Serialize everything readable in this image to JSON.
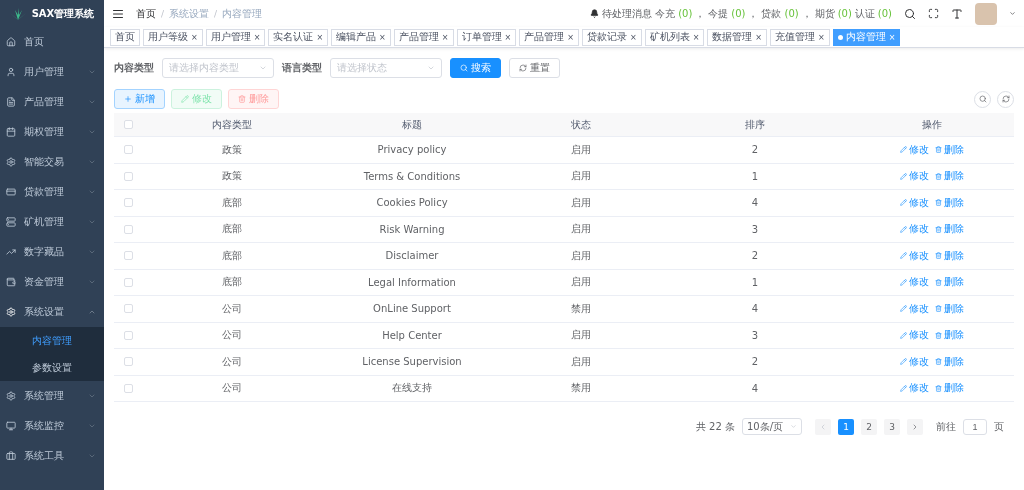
{
  "sidebar": {
    "brand": "SAX管理系统",
    "items": [
      {
        "label": "首页",
        "expandable": false,
        "expanded": false
      },
      {
        "label": "用户管理",
        "expandable": true,
        "expanded": false
      },
      {
        "label": "产品管理",
        "expandable": true,
        "expanded": false
      },
      {
        "label": "期权管理",
        "expandable": true,
        "expanded": false
      },
      {
        "label": "智能交易",
        "expandable": true,
        "expanded": false
      },
      {
        "label": "贷款管理",
        "expandable": true,
        "expanded": false
      },
      {
        "label": "矿机管理",
        "expandable": true,
        "expanded": false
      },
      {
        "label": "数字藏品",
        "expandable": true,
        "expanded": false
      },
      {
        "label": "资金管理",
        "expandable": true,
        "expanded": false
      },
      {
        "label": "系统设置",
        "expandable": true,
        "expanded": true,
        "children": [
          {
            "label": "内容管理",
            "selected": true
          },
          {
            "label": "参数设置",
            "selected": false
          }
        ]
      },
      {
        "label": "系统管理",
        "expandable": true,
        "expanded": false
      },
      {
        "label": "系统监控",
        "expandable": true,
        "expanded": false
      },
      {
        "label": "系统工具",
        "expandable": true,
        "expanded": false
      }
    ]
  },
  "breadcrumb": {
    "separator": "/",
    "items": [
      "首页",
      "系统设置",
      "内容管理"
    ]
  },
  "notice": {
    "label": "待处理消息",
    "items": [
      {
        "label": "今充",
        "count": "(0)",
        "suffix": "，"
      },
      {
        "label": "今提",
        "count": "(0)",
        "suffix": "，"
      },
      {
        "label": "贷款",
        "count": "(0)",
        "suffix": "，"
      },
      {
        "label": "期货",
        "count": "(0)"
      },
      {
        "label": "认证",
        "count": "(0)"
      }
    ]
  },
  "tags": [
    {
      "label": "首页",
      "selected": false
    },
    {
      "label": "用户等级",
      "close": "×",
      "selected": false
    },
    {
      "label": "用户管理",
      "close": "×",
      "selected": false
    },
    {
      "label": "实名认证",
      "close": "×",
      "selected": false
    },
    {
      "label": "编辑产品",
      "close": "×",
      "selected": false
    },
    {
      "label": "产品管理",
      "close": "×",
      "selected": false
    },
    {
      "label": "订单管理",
      "close": "×",
      "selected": false
    },
    {
      "label": "产品管理",
      "close": "×",
      "selected": false
    },
    {
      "label": "贷款记录",
      "close": "×",
      "selected": false
    },
    {
      "label": "矿机列表",
      "close": "×",
      "selected": false
    },
    {
      "label": "数据管理",
      "close": "×",
      "selected": false
    },
    {
      "label": "充值管理",
      "close": "×",
      "selected": false
    },
    {
      "label": "内容管理",
      "close": "×",
      "selected": true
    }
  ],
  "filters": [
    {
      "label": "内容类型",
      "placeholder": "请选择内容类型"
    },
    {
      "label": "语言类型",
      "placeholder": "请选择状态"
    }
  ],
  "search_button": "搜索",
  "reset_button": "重置",
  "actions": [
    {
      "kind": "add",
      "label": "新增",
      "disabled": false
    },
    {
      "kind": "edit",
      "label": "修改",
      "disabled": true
    },
    {
      "kind": "delete",
      "label": "删除",
      "disabled": true
    }
  ],
  "table": {
    "all_checked": false,
    "columns": [
      "内容类型",
      "标题",
      "状态",
      "排序",
      "操作"
    ],
    "rows": [
      {
        "type": "政策",
        "title": "Privacy policy",
        "status": "启用",
        "sort": "2",
        "checked": false,
        "actions": [
          "修改",
          "删除"
        ]
      },
      {
        "type": "政策",
        "title": "Terms & Conditions",
        "status": "启用",
        "sort": "1",
        "checked": false,
        "actions": [
          "修改",
          "删除"
        ]
      },
      {
        "type": "底部",
        "title": "Cookies Policy",
        "status": "启用",
        "sort": "4",
        "checked": false,
        "actions": [
          "修改",
          "删除"
        ]
      },
      {
        "type": "底部",
        "title": "Risk Warning",
        "status": "启用",
        "sort": "3",
        "checked": false,
        "actions": [
          "修改",
          "删除"
        ]
      },
      {
        "type": "底部",
        "title": "Disclaimer",
        "status": "启用",
        "sort": "2",
        "checked": false,
        "actions": [
          "修改",
          "删除"
        ]
      },
      {
        "type": "底部",
        "title": "Legal Information",
        "status": "启用",
        "sort": "1",
        "checked": false,
        "actions": [
          "修改",
          "删除"
        ]
      },
      {
        "type": "公司",
        "title": "OnLine Support",
        "status": "禁用",
        "sort": "4",
        "checked": false,
        "actions": [
          "修改",
          "删除"
        ]
      },
      {
        "type": "公司",
        "title": "Help Center",
        "status": "启用",
        "sort": "3",
        "checked": false,
        "actions": [
          "修改",
          "删除"
        ]
      },
      {
        "type": "公司",
        "title": "License Supervision",
        "status": "启用",
        "sort": "2",
        "checked": false,
        "actions": [
          "修改",
          "删除"
        ]
      },
      {
        "type": "公司",
        "title": "在线支持",
        "status": "禁用",
        "sort": "4",
        "checked": false,
        "actions": [
          "修改",
          "删除"
        ]
      }
    ]
  },
  "pagination": {
    "total": "共 22 条",
    "page_size": "10条/页",
    "pages": [
      {
        "label": "1",
        "selected": true
      },
      {
        "label": "2",
        "selected": false
      },
      {
        "label": "3",
        "selected": false
      }
    ],
    "goto_label": "前往",
    "goto_value": "1",
    "goto_suffix": "页"
  }
}
